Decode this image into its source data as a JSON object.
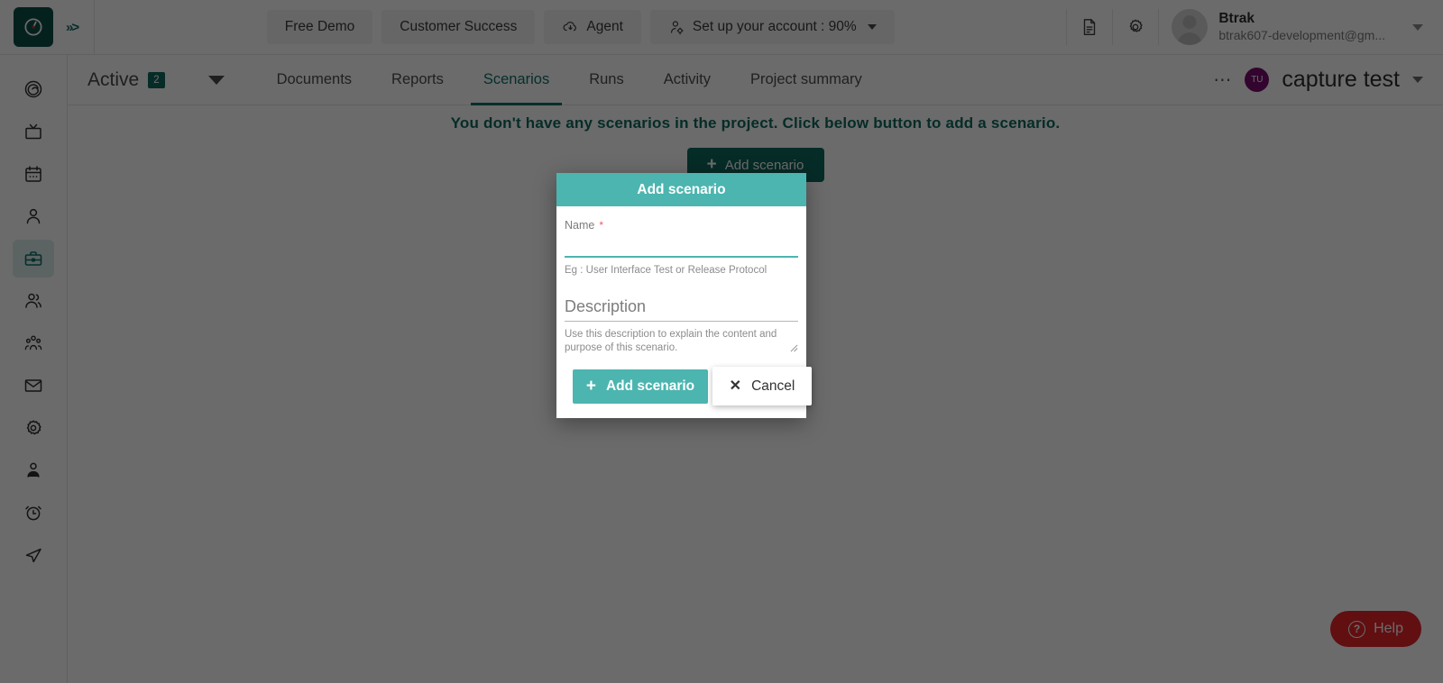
{
  "topbar": {
    "logo_icon": "clock-logo-icon",
    "collapse_icon": "chevrons-right-icon",
    "nav_items": [
      {
        "label": "Free Demo",
        "icon": null
      },
      {
        "label": "Customer Success",
        "icon": null
      },
      {
        "label": "Agent",
        "icon": "cloud-download-icon"
      },
      {
        "label": "Set up your account : 90%",
        "icon": "user-settings-icon",
        "has_caret": true
      }
    ],
    "doc_icon": "document-icon",
    "gear_icon": "gear-icon",
    "user": {
      "name": "Btrak",
      "email": "btrak607-development@gm...",
      "avatar_icon": "user-avatar-icon"
    }
  },
  "sidebar": {
    "items": [
      {
        "name": "sidebar-item-target",
        "icon": "target-spiral-icon",
        "active": false
      },
      {
        "name": "sidebar-item-tv",
        "icon": "tv-icon",
        "active": false
      },
      {
        "name": "sidebar-item-calendar",
        "icon": "calendar-icon",
        "active": false
      },
      {
        "name": "sidebar-item-user",
        "icon": "user-icon",
        "active": false
      },
      {
        "name": "sidebar-item-projects",
        "icon": "briefcase-icon",
        "active": true
      },
      {
        "name": "sidebar-item-team",
        "icon": "users-icon",
        "active": false
      },
      {
        "name": "sidebar-item-group",
        "icon": "user-group-icon",
        "active": false
      },
      {
        "name": "sidebar-item-mail",
        "icon": "envelope-icon",
        "active": false
      },
      {
        "name": "sidebar-item-settings",
        "icon": "gear-icon",
        "active": false
      },
      {
        "name": "sidebar-item-profile",
        "icon": "person-badge-icon",
        "active": false
      },
      {
        "name": "sidebar-item-timer",
        "icon": "alarm-clock-icon",
        "active": false
      },
      {
        "name": "sidebar-item-send",
        "icon": "paper-plane-icon",
        "active": false
      }
    ]
  },
  "tabsrow": {
    "filter": {
      "label": "Active",
      "count": "2",
      "caret_icon": "caret-down-icon"
    },
    "tabs": [
      {
        "label": "Documents",
        "selected": false
      },
      {
        "label": "Reports",
        "selected": false
      },
      {
        "label": "Scenarios",
        "selected": true
      },
      {
        "label": "Runs",
        "selected": false
      },
      {
        "label": "Activity",
        "selected": false
      },
      {
        "label": "Project summary",
        "selected": false
      }
    ],
    "project": {
      "more_icon": "more-horizontal-icon",
      "avatar_initials": "TU",
      "name": "capture test",
      "caret_icon": "caret-down-icon"
    }
  },
  "content": {
    "empty_message": "You don't have any scenarios in the project. Click below button to add a scenario.",
    "add_button_label": "Add scenario",
    "add_button_icon": "plus-icon"
  },
  "modal": {
    "title": "Add scenario",
    "name_field": {
      "label": "Name",
      "required_marker": "*",
      "value": "",
      "placeholder": "",
      "helper": "Eg : User Interface Test or Release Protocol"
    },
    "description_field": {
      "placeholder": "Description",
      "value": "",
      "helper": "Use this description to explain the content and purpose of this scenario."
    },
    "submit_label": "Add scenario",
    "submit_icon": "plus-icon",
    "cancel_label": "Cancel",
    "cancel_icon": "close-x-icon"
  },
  "help": {
    "label": "Help",
    "icon": "question-circle-icon"
  },
  "colors": {
    "brand_dark_teal": "#0f6a5e",
    "brand_teal": "#4cb5b0",
    "accent_red": "#e8242a",
    "avatar_purple": "#7b0e6e",
    "required_pink": "#f0596b"
  }
}
